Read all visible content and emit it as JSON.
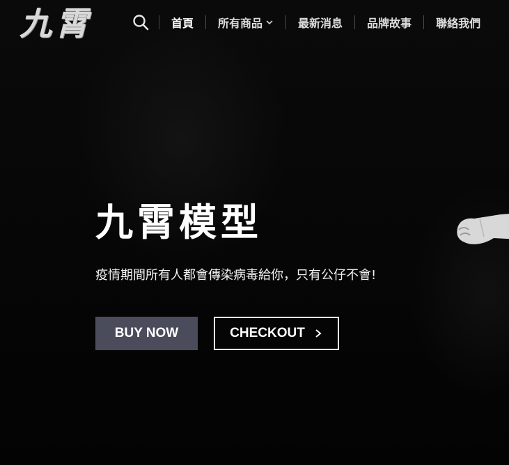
{
  "brand": {
    "logo_text": "九霄"
  },
  "header": {
    "search_icon": "search-icon",
    "nav": [
      {
        "label": "首頁",
        "active": true
      },
      {
        "label": "所有商品",
        "has_dropdown": true
      },
      {
        "label": "最新消息"
      },
      {
        "label": "品牌故事"
      },
      {
        "label": "聯絡我們"
      }
    ]
  },
  "hero": {
    "title": "九霄模型",
    "subtitle": "疫情期間所有人都會傳染病毒給你，只有公仔不會!",
    "buy_button": "BUY NOW",
    "checkout_button": "CHECKOUT"
  },
  "colors": {
    "background": "#050505",
    "buy_button_bg": "#4a4c5c",
    "text": "#ffffff"
  }
}
